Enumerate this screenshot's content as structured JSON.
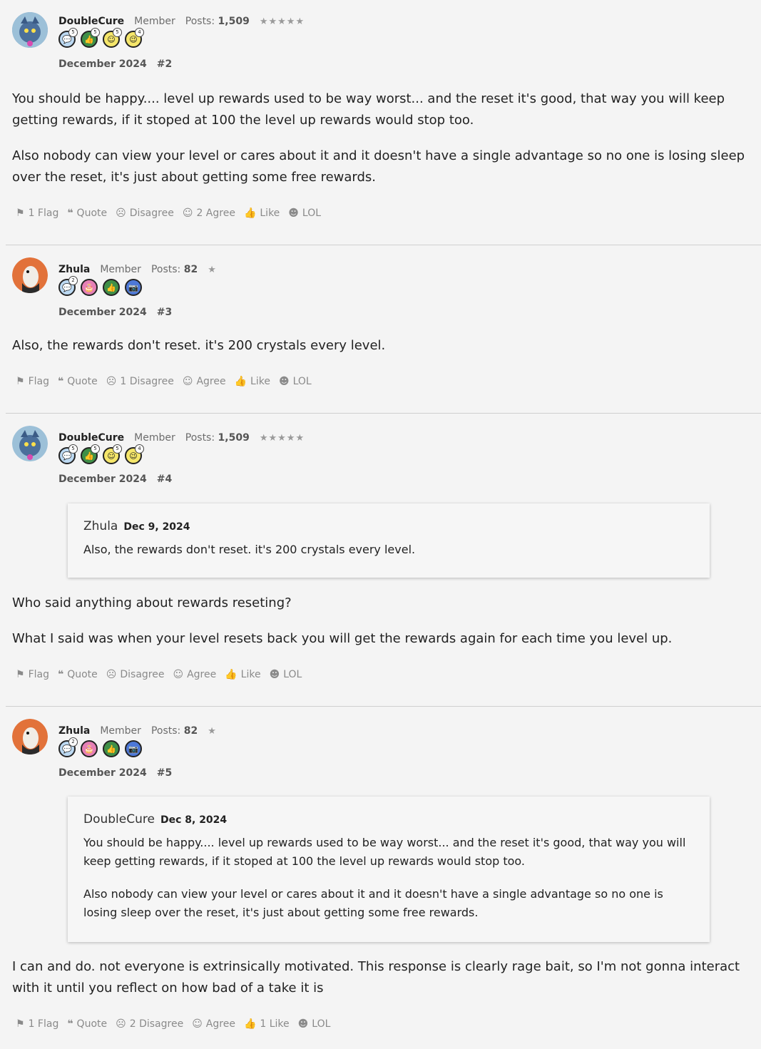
{
  "posts": [
    {
      "user": "DoubleCure",
      "role": "Member",
      "posts_label": "Posts:",
      "posts_count": "1,509",
      "stars": "★★★★★",
      "badges": [
        {
          "icon": "speech-bubble-icon",
          "color": "#bcd9f2",
          "count": "5"
        },
        {
          "icon": "thumbs-up-icon",
          "color": "#3f8f47",
          "count": "5"
        },
        {
          "icon": "smiley-icon",
          "color": "#f5e66a",
          "count": "5"
        },
        {
          "icon": "wink-icon",
          "color": "#f5e66a",
          "count": "4"
        }
      ],
      "date": "December 2024",
      "num": "#2",
      "paragraphs": [
        "You should be happy.... level up rewards used to be way worst... and the reset it's good, that way you will keep getting rewards, if it stoped at 100 the level up rewards would stop too.",
        "Also nobody can view your level or cares about it and it doesn't have a single advantage so no one is losing sleep over the reset, it's just about getting some free rewards."
      ],
      "actions": [
        "1 Flag",
        "Quote",
        "Disagree",
        "2 Agree",
        "Like",
        "LOL"
      ]
    },
    {
      "user": "Zhula",
      "role": "Member",
      "posts_label": "Posts:",
      "posts_count": "82",
      "stars": "★",
      "badges": [
        {
          "icon": "speech-bubble-icon",
          "color": "#bcd9f2",
          "count": "2"
        },
        {
          "icon": "cake-icon",
          "color": "#e57fb5",
          "count": ""
        },
        {
          "icon": "thumbs-up-icon",
          "color": "#3f8f47",
          "count": ""
        },
        {
          "icon": "camera-icon",
          "color": "#4d78d8",
          "count": ""
        }
      ],
      "date": "December 2024",
      "num": "#3",
      "paragraphs": [
        "Also, the rewards don't reset. it's 200 crystals every level."
      ],
      "actions": [
        "Flag",
        "Quote",
        "1 Disagree",
        "Agree",
        "Like",
        "LOL"
      ]
    },
    {
      "user": "DoubleCure",
      "role": "Member",
      "posts_label": "Posts:",
      "posts_count": "1,509",
      "stars": "★★★★★",
      "badges": [
        {
          "icon": "speech-bubble-icon",
          "color": "#bcd9f2",
          "count": "5"
        },
        {
          "icon": "thumbs-up-icon",
          "color": "#3f8f47",
          "count": "5"
        },
        {
          "icon": "smiley-icon",
          "color": "#f5e66a",
          "count": "5"
        },
        {
          "icon": "wink-icon",
          "color": "#f5e66a",
          "count": "4"
        }
      ],
      "date": "December 2024",
      "num": "#4",
      "quote": {
        "author": "Zhula",
        "date": "Dec 9, 2024",
        "paragraphs": [
          "Also, the rewards don't reset. it's 200 crystals every level."
        ]
      },
      "paragraphs": [
        "Who said anything about rewards reseting?",
        "What I said was when your level resets back you will get the rewards again for each time you level up."
      ],
      "actions": [
        "Flag",
        "Quote",
        "Disagree",
        "Agree",
        "Like",
        "LOL"
      ]
    },
    {
      "user": "Zhula",
      "role": "Member",
      "posts_label": "Posts:",
      "posts_count": "82",
      "stars": "★",
      "badges": [
        {
          "icon": "speech-bubble-icon",
          "color": "#bcd9f2",
          "count": "2"
        },
        {
          "icon": "cake-icon",
          "color": "#e57fb5",
          "count": ""
        },
        {
          "icon": "thumbs-up-icon",
          "color": "#3f8f47",
          "count": ""
        },
        {
          "icon": "camera-icon",
          "color": "#4d78d8",
          "count": ""
        }
      ],
      "date": "December 2024",
      "num": "#5",
      "quote": {
        "author": "DoubleCure",
        "date": "Dec 8, 2024",
        "paragraphs": [
          "You should be happy.... level up rewards used to be way worst... and the reset it's good, that way you will keep getting rewards, if it stoped at 100 the level up rewards would stop too.",
          "Also nobody can view your level or cares about it and it doesn't have a single advantage so no one is losing sleep over the reset, it's just about getting some free rewards."
        ]
      },
      "paragraphs": [
        "I can and do. not everyone is extrinsically motivated. This response is clearly rage bait, so I'm not gonna interact with it until you reflect on how bad of a take it is"
      ],
      "actions": [
        "1 Flag",
        "Quote",
        "2 Disagree",
        "Agree",
        "1 Like",
        "LOL"
      ]
    }
  ],
  "colors": {
    "doublecure_avatar": "#5a7fa8",
    "zhula_avatar": "#e2723a",
    "text": "#222222",
    "muted": "#8a8a8a"
  }
}
